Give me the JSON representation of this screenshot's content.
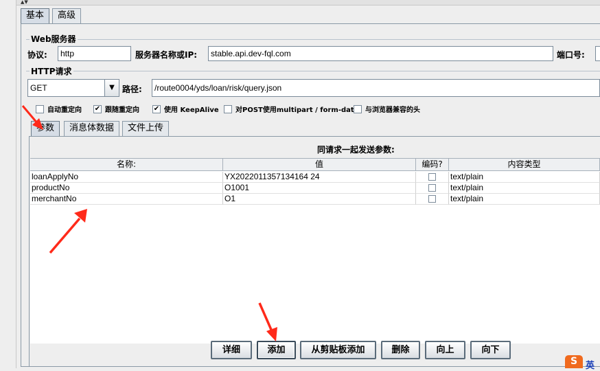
{
  "tabs_top": [
    {
      "label": "基本",
      "active": true
    },
    {
      "label": "高级",
      "active": false
    }
  ],
  "web_server": {
    "group_title": "Web服务器",
    "protocol_label": "协议:",
    "protocol_value": "http",
    "server_label": "服务器名称或IP:",
    "server_value": "stable.api.dev-fql.com",
    "port_label": "端口号:"
  },
  "http_request": {
    "group_title": "HTTP请求",
    "method_value": "GET",
    "path_label": "路径:",
    "path_value": "/route0004/yds/loan/risk/query.json"
  },
  "checkboxes": [
    {
      "label": "自动重定向",
      "checked": false
    },
    {
      "label": "跟随重定向",
      "checked": true
    },
    {
      "label": "使用 KeepAlive",
      "checked": true
    },
    {
      "label": "对POST使用multipart / form-data",
      "checked": false
    },
    {
      "label": "与浏览器兼容的头",
      "checked": false
    }
  ],
  "inner_tabs": [
    {
      "label": "参数",
      "active": true
    },
    {
      "label": "消息体数据",
      "active": false
    },
    {
      "label": "文件上传",
      "active": false
    }
  ],
  "params": {
    "title": "同请求一起发送参数:",
    "columns": [
      "名称:",
      "值",
      "编码?",
      "内容类型"
    ],
    "rows": [
      {
        "name": "loanApplyNo",
        "value": "YX2022011357134164 24",
        "encode": false,
        "content_type": "text/plain"
      },
      {
        "name": "productNo",
        "value": "O1001",
        "encode": false,
        "content_type": "text/plain"
      },
      {
        "name": "merchantNo",
        "value": "O1",
        "encode": false,
        "content_type": "text/plain"
      }
    ]
  },
  "buttons": {
    "detail": "详细",
    "add": "添加",
    "add_clipboard": "从剪贴板添加",
    "delete": "删除",
    "up": "向上",
    "down": "向下"
  },
  "ime": {
    "label": "英"
  },
  "colors": {
    "annotation_arrow": "#ff2a1a",
    "ime_orange": "#f06a1e"
  }
}
